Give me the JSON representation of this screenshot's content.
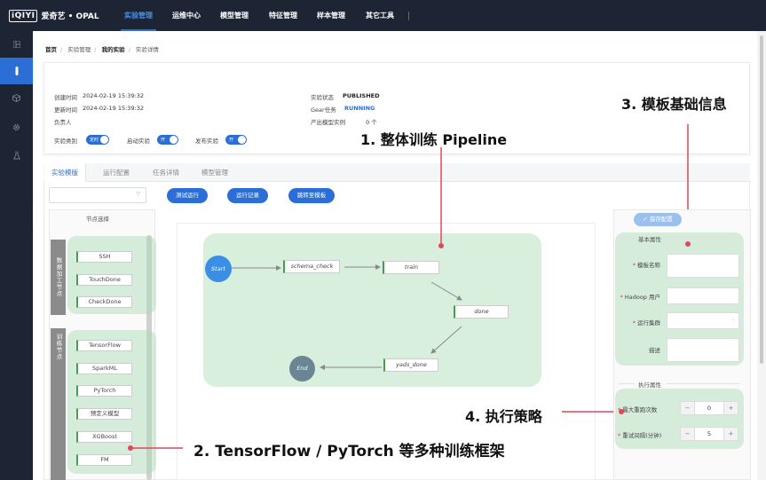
{
  "nav": {
    "logo_mark": "iQIYI",
    "logo_text": "爱奇艺 • OPAL",
    "items": [
      "实验管理",
      "运维中心",
      "模型管理",
      "特征管理",
      "样本管理",
      "其它工具"
    ]
  },
  "sidebar": {
    "icons": [
      "dashboard-icon",
      "experiment-icon",
      "cube-icon",
      "gear-icon",
      "flask-icon"
    ]
  },
  "breadcrumb": [
    "首页",
    "实验管理",
    "我的实验",
    "实验详情"
  ],
  "info": {
    "created_label": "创建时间",
    "created_value": "2024-02-19 15:39:32",
    "updated_label": "更新时间",
    "updated_value": "2024-02-19 15:39:32",
    "owner_label": "负责人",
    "status_label": "实验状态",
    "status_value": "PUBLISHED",
    "gear_label": "Gear任务",
    "gear_value": "RUNNING",
    "models_label": "产出模型实例",
    "models_value": "0 个",
    "type_label": "实验类别",
    "type_toggle": "定时",
    "start_label": "启动实验",
    "start_toggle": "开",
    "publish_label": "发布实验",
    "publish_toggle": "开"
  },
  "tabs": [
    "实验模版",
    "运行配置",
    "任务详情",
    "模型管理"
  ],
  "buttons": {
    "test_run": "测试运行",
    "run_records": "运行记录",
    "jump_template": "跳转至模板"
  },
  "node_panel": {
    "title": "节点选择",
    "category_data": "数据加工节点",
    "category_train": "训练节点",
    "data_nodes": [
      "SSH",
      "TouchDone",
      "CheckDone"
    ],
    "train_nodes": [
      "TensorFlow",
      "SparkML",
      "PyTorch",
      "预定义模型",
      "XGBoost",
      "FM"
    ]
  },
  "pipeline": {
    "start": "Start",
    "end": "End",
    "nodes": [
      "schema_check",
      "train",
      "done",
      "yads_done"
    ]
  },
  "props": {
    "save_label": "保存配置",
    "basic_title": "基本属性",
    "template_name": "模板名称",
    "hadoop_user": "Hadoop 用户",
    "cluster": "运行集群",
    "description": "描述",
    "exec_title": "执行属性",
    "max_retries": "最大重跑次数",
    "max_retries_value": "0",
    "retry_interval": "重试间隔(分钟)",
    "retry_interval_value": "5",
    "minus": "−",
    "plus": "+"
  },
  "annotations": {
    "a1": "1. 整体训练 Pipeline",
    "a2": "2. TensorFlow / PyTorch 等多种训练框架",
    "a3": "3. 模板基础信息",
    "a4": "4. 执行策略"
  },
  "colors": {
    "nav_bg": "#1d2433",
    "accent": "#2b6fd6",
    "group_green": "#aadcb4",
    "annotation_red": "#e0475a"
  }
}
